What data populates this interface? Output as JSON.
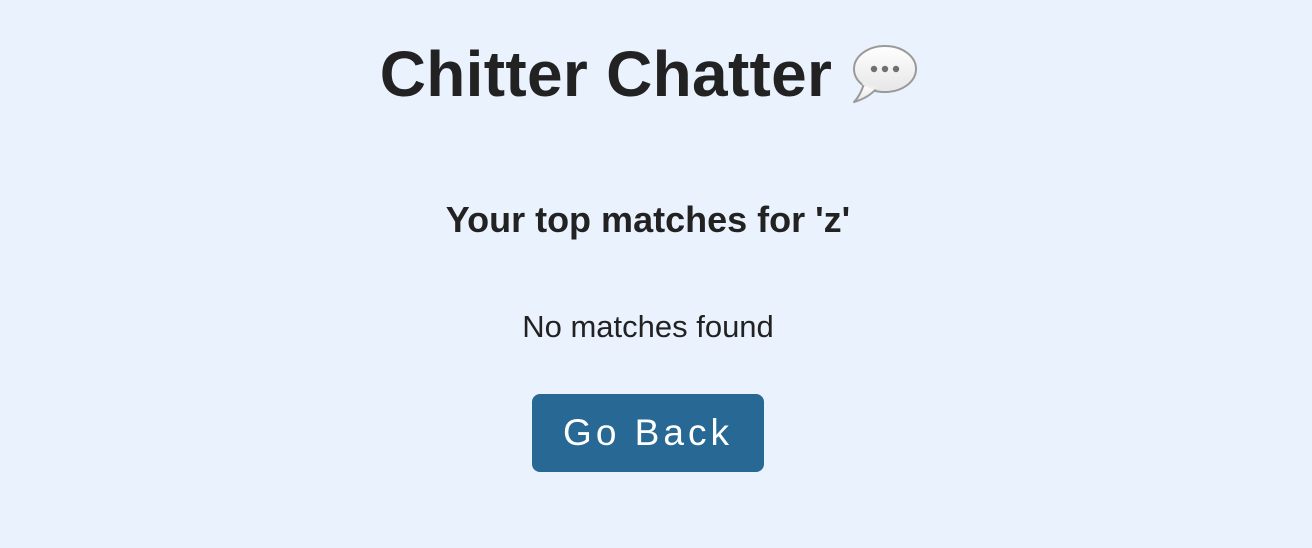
{
  "header": {
    "title": "Chitter Chatter",
    "title_icon": "speech-bubble-icon"
  },
  "results": {
    "heading": "Your top matches for 'z'",
    "empty_message": "No matches found"
  },
  "actions": {
    "back_label": "Go Back"
  },
  "colors": {
    "background": "#eaf2fe",
    "text": "#222222",
    "button": "#276894",
    "button_text": "#ffffff"
  }
}
